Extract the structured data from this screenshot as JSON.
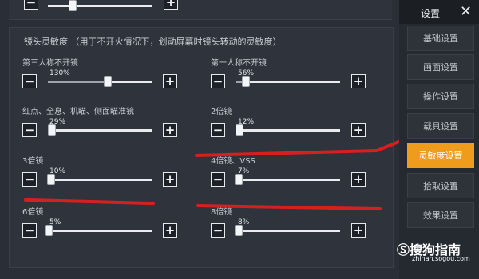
{
  "sidebar": {
    "title": "设置",
    "close_icon": "close-icon",
    "items": [
      {
        "label": "基础设置",
        "active": false
      },
      {
        "label": "画面设置",
        "active": false
      },
      {
        "label": "操作设置",
        "active": false
      },
      {
        "label": "载具设置",
        "active": false
      },
      {
        "label": "灵敏度设置",
        "active": true
      },
      {
        "label": "拾取设置",
        "active": false
      },
      {
        "label": "效果设置",
        "active": false
      }
    ]
  },
  "section": {
    "title": "镜头灵敏度 （用于不开火情况下，划动屏幕时镜头转动的灵敏度）"
  },
  "sliders": [
    {
      "label": "第三人称不开镜",
      "value": "130%",
      "level": 0.58
    },
    {
      "label": "第一人称不开镜",
      "value": "56%",
      "level": 0.09
    },
    {
      "label": "红点、全息、机瞄、侧面瞄准镜",
      "value": "29%",
      "level": 0.04
    },
    {
      "label": "2倍镜",
      "value": "12%",
      "level": 0.03
    },
    {
      "label": "3倍镜",
      "value": "10%",
      "level": 0.03
    },
    {
      "label": "4倍镜、VSS",
      "value": "7%",
      "level": 0.02
    },
    {
      "label": "6倍镜",
      "value": "5%",
      "level": 0.01
    },
    {
      "label": "8倍镜",
      "value": "8%",
      "level": 0.02
    }
  ],
  "buttons": {
    "minus": "−",
    "plus": "+"
  },
  "watermark": {
    "brand": "搜狗指南",
    "url": "zhinan.sogou.com",
    "icon": "sogou-logo"
  },
  "colors": {
    "accent": "#ef9b1c",
    "annotation": "#d61f1f"
  }
}
